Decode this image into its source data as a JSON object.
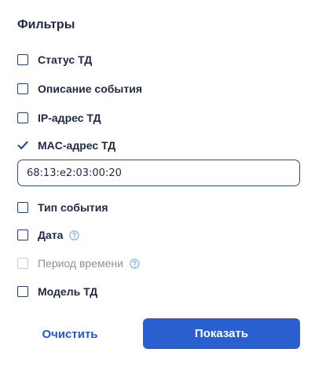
{
  "panel": {
    "title": "Фильтры",
    "filters": [
      {
        "label": "Статус ТД",
        "checked": false
      },
      {
        "label": "Описание события",
        "checked": false
      },
      {
        "label": "IP-адрес ТД",
        "checked": false
      },
      {
        "label": "MAC-адрес ТД",
        "checked": true
      },
      {
        "label": "Тип события",
        "checked": false
      },
      {
        "label": "Дата",
        "checked": false,
        "help_icon": "question-circle-icon"
      },
      {
        "label": "Период времени",
        "checked": false,
        "disabled": true,
        "help_icon": "question-circle-icon"
      },
      {
        "label": "Модель ТД",
        "checked": false
      }
    ],
    "mac_input": {
      "value": "68:13:e2:03:00:20"
    },
    "actions": {
      "clear_label": "Очистить",
      "show_label": "Показать"
    }
  },
  "colors": {
    "accent": "#2a5fd0",
    "checkbox_border": "#1d3f86",
    "text": "#1e2a45",
    "disabled_text": "#8a909c",
    "help_icon": "#7fa6e6"
  }
}
